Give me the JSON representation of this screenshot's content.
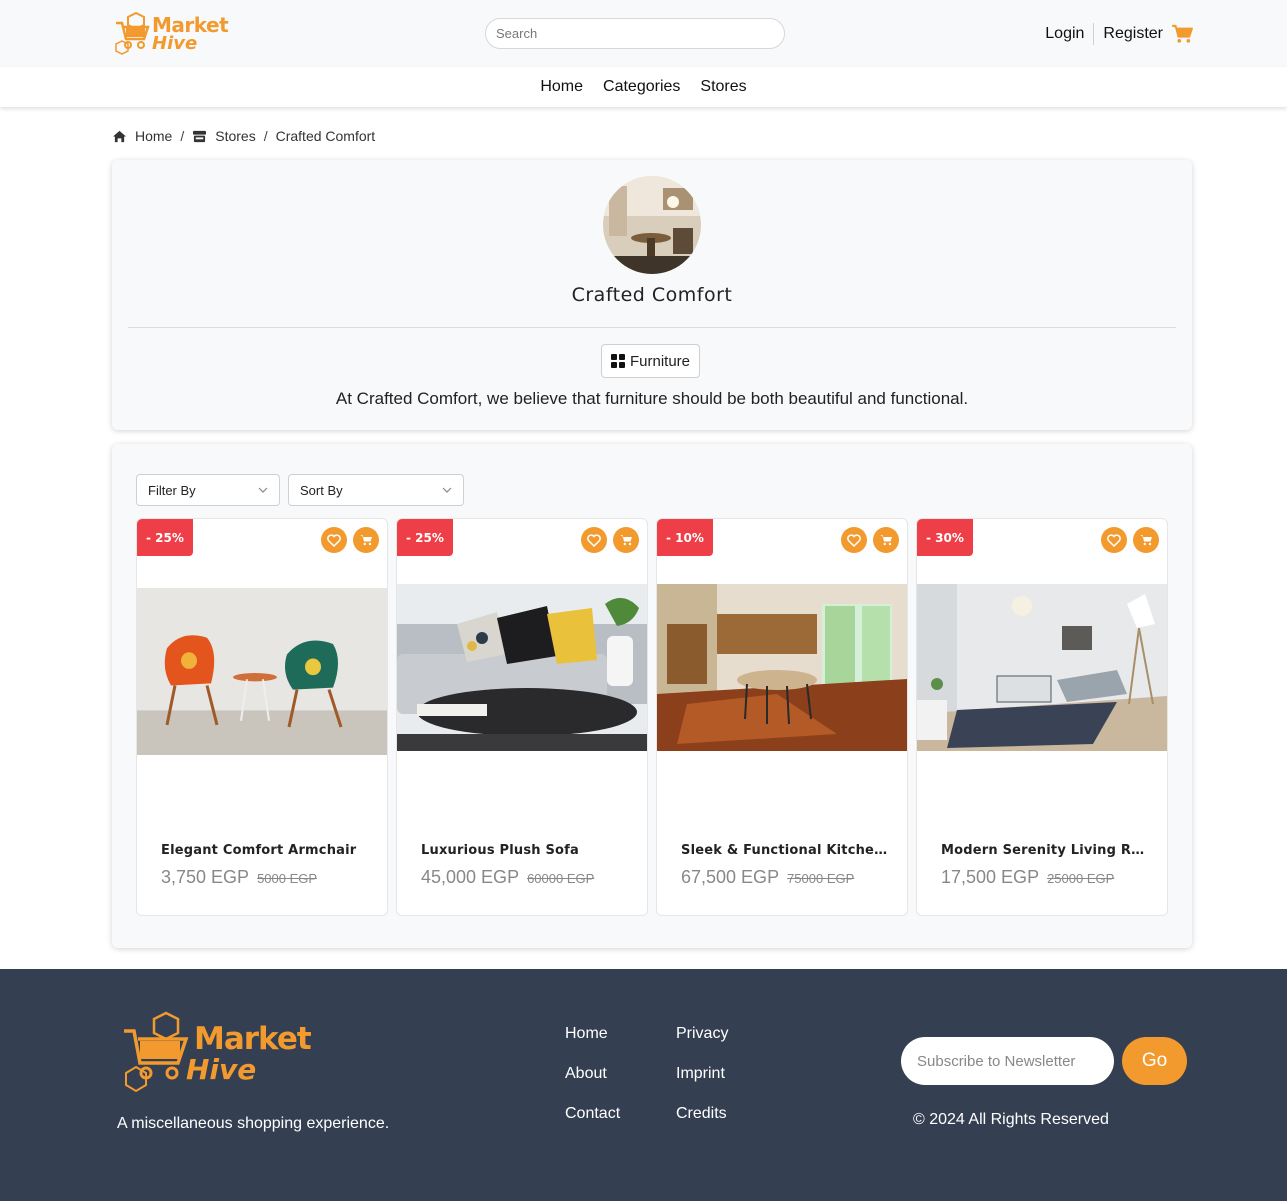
{
  "header": {
    "logo": {
      "word1": "Market",
      "word2": "Hive"
    },
    "search_placeholder": "Search",
    "login_label": "Login",
    "register_label": "Register",
    "cart_icon": "cart-icon"
  },
  "mainnav": {
    "items": [
      "Home",
      "Categories",
      "Stores"
    ]
  },
  "breadcrumb": {
    "home": "Home",
    "stores": "Stores",
    "current": "Crafted Comfort"
  },
  "store": {
    "name": "Crafted Comfort",
    "category": "Furniture",
    "description": "At Crafted Comfort, we believe that furniture should be both beautiful and functional."
  },
  "filters": {
    "filter_label": "Filter By",
    "sort_label": "Sort By"
  },
  "products": [
    {
      "discount": "- 25%",
      "name": "Elegant Comfort Armchair",
      "price": "3,750 EGP",
      "old_price": "5000 EGP"
    },
    {
      "discount": "- 25%",
      "name": "Luxurious Plush Sofa",
      "price": "45,000 EGP",
      "old_price": "60000 EGP"
    },
    {
      "discount": "- 10%",
      "name": "Sleek & Functional Kitchen C...",
      "price": "67,500 EGP",
      "old_price": "75000 EGP"
    },
    {
      "discount": "- 30%",
      "name": "Modern Serenity Living Roo...",
      "price": "17,500 EGP",
      "old_price": "25000 EGP"
    }
  ],
  "footer": {
    "logo": {
      "word1": "Market",
      "word2": "Hive"
    },
    "tagline": "A miscellaneous shopping experience.",
    "col1": [
      "Home",
      "About",
      "Contact"
    ],
    "col2": [
      "Privacy",
      "Imprint",
      "Credits"
    ],
    "newsletter_placeholder": "Subscribe to Newsletter",
    "go_label": "Go",
    "copyright": "© 2024 All Rights Reserved"
  },
  "colors": {
    "accent": "#f29a2e",
    "discount": "#ee3f48",
    "footer_bg": "#343f52"
  }
}
